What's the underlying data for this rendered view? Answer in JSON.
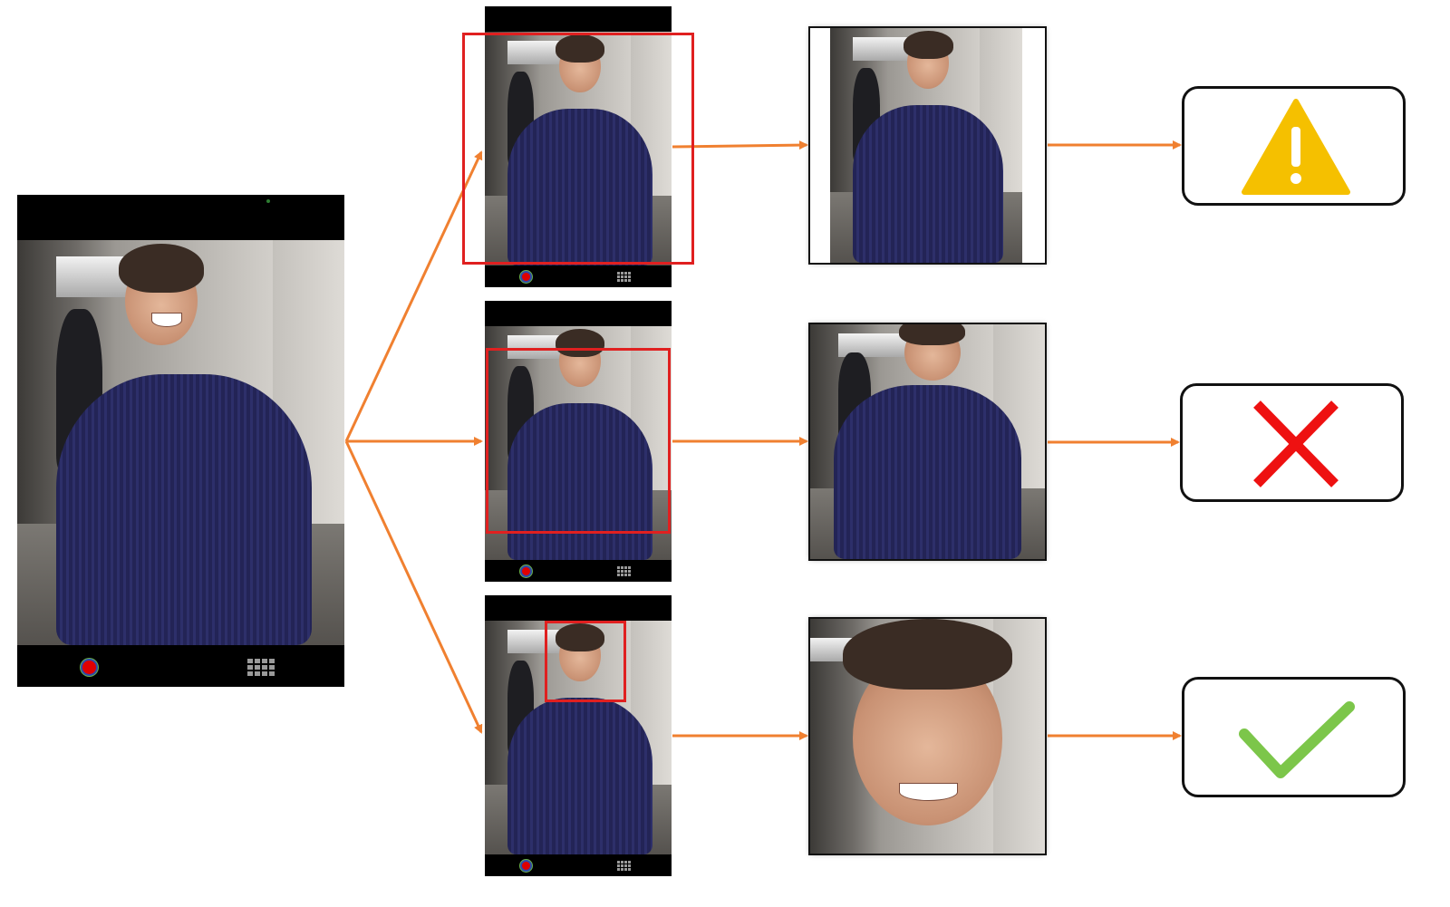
{
  "colors": {
    "arrow": "#f08030",
    "crop_box": "#e02020",
    "warning": "#f5c000",
    "cross": "#ee1111",
    "check": "#7cc64a",
    "rec_button": "#e00000"
  },
  "source": {
    "description_icon_names": [
      "record-button-icon",
      "grid-menu-icon"
    ]
  },
  "rows": [
    {
      "crop_level": "wide",
      "outcome_icon": "warning-icon"
    },
    {
      "crop_level": "medium",
      "outcome_icon": "cross-icon"
    },
    {
      "crop_level": "tight",
      "outcome_icon": "check-icon"
    }
  ]
}
